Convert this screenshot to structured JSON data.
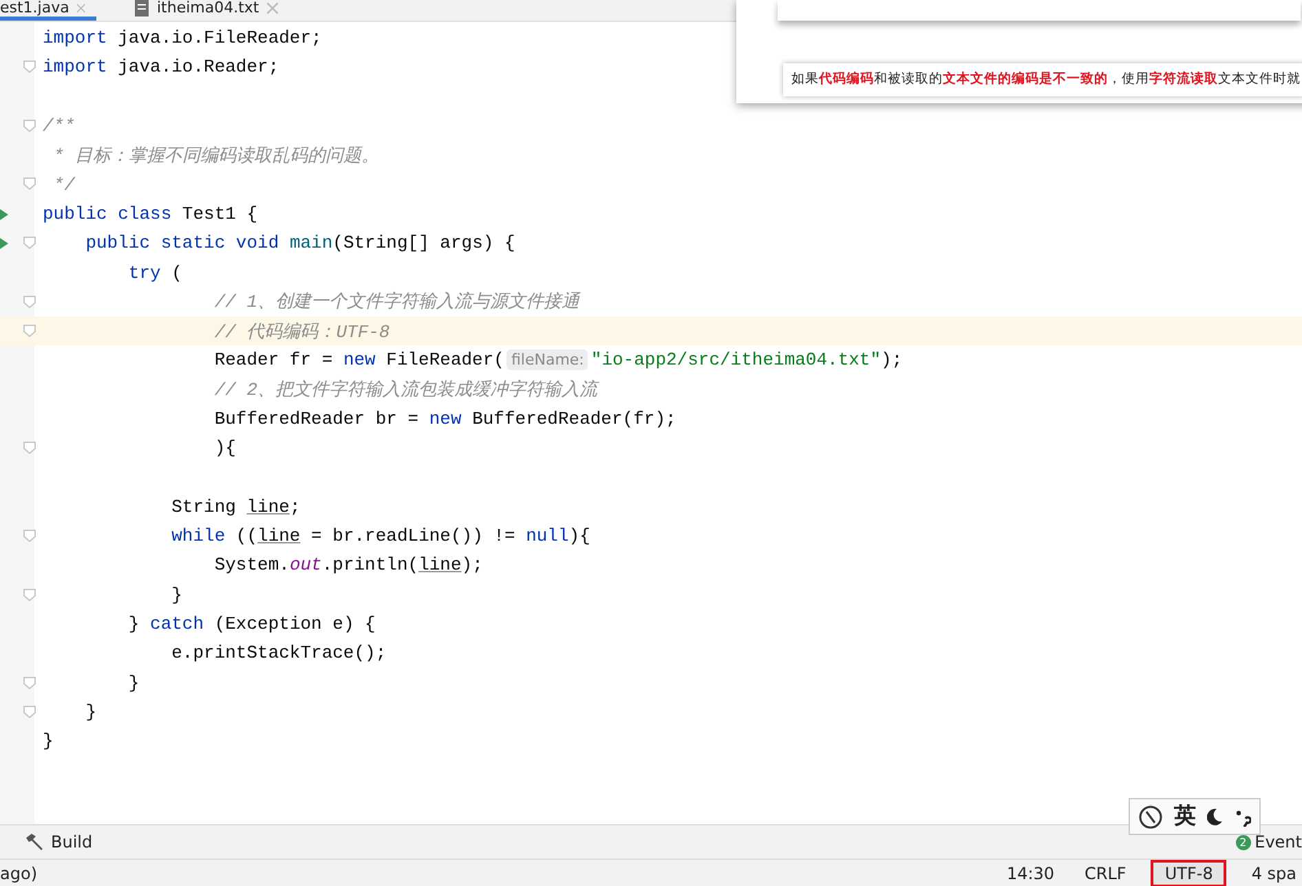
{
  "tabs": [
    {
      "label": "est1.java",
      "selected": true,
      "kind": "java"
    },
    {
      "label": "itheima04.txt",
      "selected": false,
      "kind": "text"
    }
  ],
  "editor": {
    "lines": [
      {
        "kind": "code",
        "tokens": [
          {
            "t": "import",
            "kind": "kw"
          },
          {
            "t": " java.io.FileReader;",
            "kind": "plain"
          }
        ]
      },
      {
        "kind": "code",
        "fold": true,
        "tokens": [
          {
            "t": "import",
            "kind": "kw"
          },
          {
            "t": " java.io.Reader;",
            "kind": "plain"
          }
        ]
      },
      {
        "kind": "blank"
      },
      {
        "kind": "code",
        "fold": true,
        "tokens": [
          {
            "t": "/**",
            "kind": "comment"
          }
        ]
      },
      {
        "kind": "code",
        "tokens": [
          {
            "t": " * 目标：掌握不同编码读取乱码的问题。",
            "kind": "comment"
          }
        ]
      },
      {
        "kind": "code",
        "fold": true,
        "tokens": [
          {
            "t": " */",
            "kind": "comment"
          }
        ]
      },
      {
        "kind": "code",
        "run": true,
        "tokens": [
          {
            "t": "public class",
            "kind": "kw"
          },
          {
            "t": " Test1 {",
            "kind": "plain"
          }
        ]
      },
      {
        "kind": "code",
        "run": true,
        "fold": true,
        "tokens": [
          {
            "t": "    public static void",
            "kind": "kw"
          },
          {
            "t": " main",
            "kind": "method"
          },
          {
            "t": "(String[] args) {",
            "kind": "plain"
          }
        ]
      },
      {
        "kind": "code",
        "tokens": [
          {
            "t": "        try",
            "kind": "kw"
          },
          {
            "t": " (",
            "kind": "plain"
          }
        ]
      },
      {
        "kind": "code",
        "fold": true,
        "tokens": [
          {
            "t": "                // 1、创建一个文件字符输入流与源文件接通",
            "kind": "comment"
          }
        ]
      },
      {
        "kind": "code",
        "fold": true,
        "current": true,
        "tokens": [
          {
            "t": "                // 代码编码：UTF-8",
            "kind": "comment"
          }
        ]
      },
      {
        "kind": "code",
        "tokens": [
          {
            "t": "                Reader fr = ",
            "kind": "plain"
          },
          {
            "t": "new",
            "kind": "kw"
          },
          {
            "t": " FileReader(",
            "kind": "plain"
          },
          {
            "t": "fileName:",
            "kind": "hint"
          },
          {
            "t": "\"io-app2/src/itheima04.txt\"",
            "kind": "str"
          },
          {
            "t": ");",
            "kind": "plain"
          }
        ]
      },
      {
        "kind": "code",
        "tokens": [
          {
            "t": "                // 2、把文件字符输入流包装成缓冲字符输入流",
            "kind": "comment"
          }
        ]
      },
      {
        "kind": "code",
        "tokens": [
          {
            "t": "                BufferedReader br = ",
            "kind": "plain"
          },
          {
            "t": "new",
            "kind": "kw"
          },
          {
            "t": " BufferedReader(fr);",
            "kind": "plain"
          }
        ]
      },
      {
        "kind": "code",
        "fold": true,
        "tokens": [
          {
            "t": "                ){",
            "kind": "plain"
          }
        ]
      },
      {
        "kind": "blank"
      },
      {
        "kind": "code",
        "tokens": [
          {
            "t": "            String ",
            "kind": "plain"
          },
          {
            "t": "line",
            "kind": "underline"
          },
          {
            "t": ";",
            "kind": "plain"
          }
        ]
      },
      {
        "kind": "code",
        "fold": true,
        "tokens": [
          {
            "t": "            while",
            "kind": "kw"
          },
          {
            "t": " ((",
            "kind": "plain"
          },
          {
            "t": "line",
            "kind": "underline"
          },
          {
            "t": " = br.readLine()) != ",
            "kind": "plain"
          },
          {
            "t": "null",
            "kind": "kw"
          },
          {
            "t": "){",
            "kind": "plain"
          }
        ]
      },
      {
        "kind": "code",
        "tokens": [
          {
            "t": "                System.",
            "kind": "plain"
          },
          {
            "t": "out",
            "kind": "field"
          },
          {
            "t": ".println(",
            "kind": "plain"
          },
          {
            "t": "line",
            "kind": "underline"
          },
          {
            "t": ");",
            "kind": "plain"
          }
        ]
      },
      {
        "kind": "code",
        "fold": true,
        "tokens": [
          {
            "t": "            }",
            "kind": "plain"
          }
        ]
      },
      {
        "kind": "code",
        "tokens": [
          {
            "t": "        } ",
            "kind": "plain"
          },
          {
            "t": "catch",
            "kind": "kw"
          },
          {
            "t": " (Exception e) {",
            "kind": "plain"
          }
        ]
      },
      {
        "kind": "code",
        "tokens": [
          {
            "t": "            e.printStackTrace();",
            "kind": "plain"
          }
        ]
      },
      {
        "kind": "code",
        "fold": true,
        "tokens": [
          {
            "t": "        }",
            "kind": "plain"
          }
        ]
      },
      {
        "kind": "code",
        "fold": true,
        "tokens": [
          {
            "t": "    }",
            "kind": "plain"
          }
        ]
      },
      {
        "kind": "code",
        "tokens": [
          {
            "t": "}",
            "kind": "plain"
          }
        ]
      }
    ]
  },
  "slide_popup": {
    "segments": [
      {
        "t": "如果",
        "emphasis": false
      },
      {
        "t": "代码编码",
        "emphasis": true
      },
      {
        "t": "和被读取的",
        "emphasis": false
      },
      {
        "t": "文本文件的编码是不一致的",
        "emphasis": true
      },
      {
        "t": "，使用",
        "emphasis": false
      },
      {
        "t": "字符流读取",
        "emphasis": true
      },
      {
        "t": "文本文件时就",
        "emphasis": false
      }
    ]
  },
  "ime_bar": {
    "label": "英"
  },
  "tool_bar": {
    "left": "Build",
    "right": "Event",
    "badge": "2"
  },
  "status_bar": {
    "left": "ago)",
    "items": [
      {
        "label": "14:30",
        "highlighted": false
      },
      {
        "label": "CRLF",
        "highlighted": false
      },
      {
        "label": "UTF-8",
        "highlighted": true
      },
      {
        "label": "4 spa",
        "highlighted": false
      }
    ]
  }
}
